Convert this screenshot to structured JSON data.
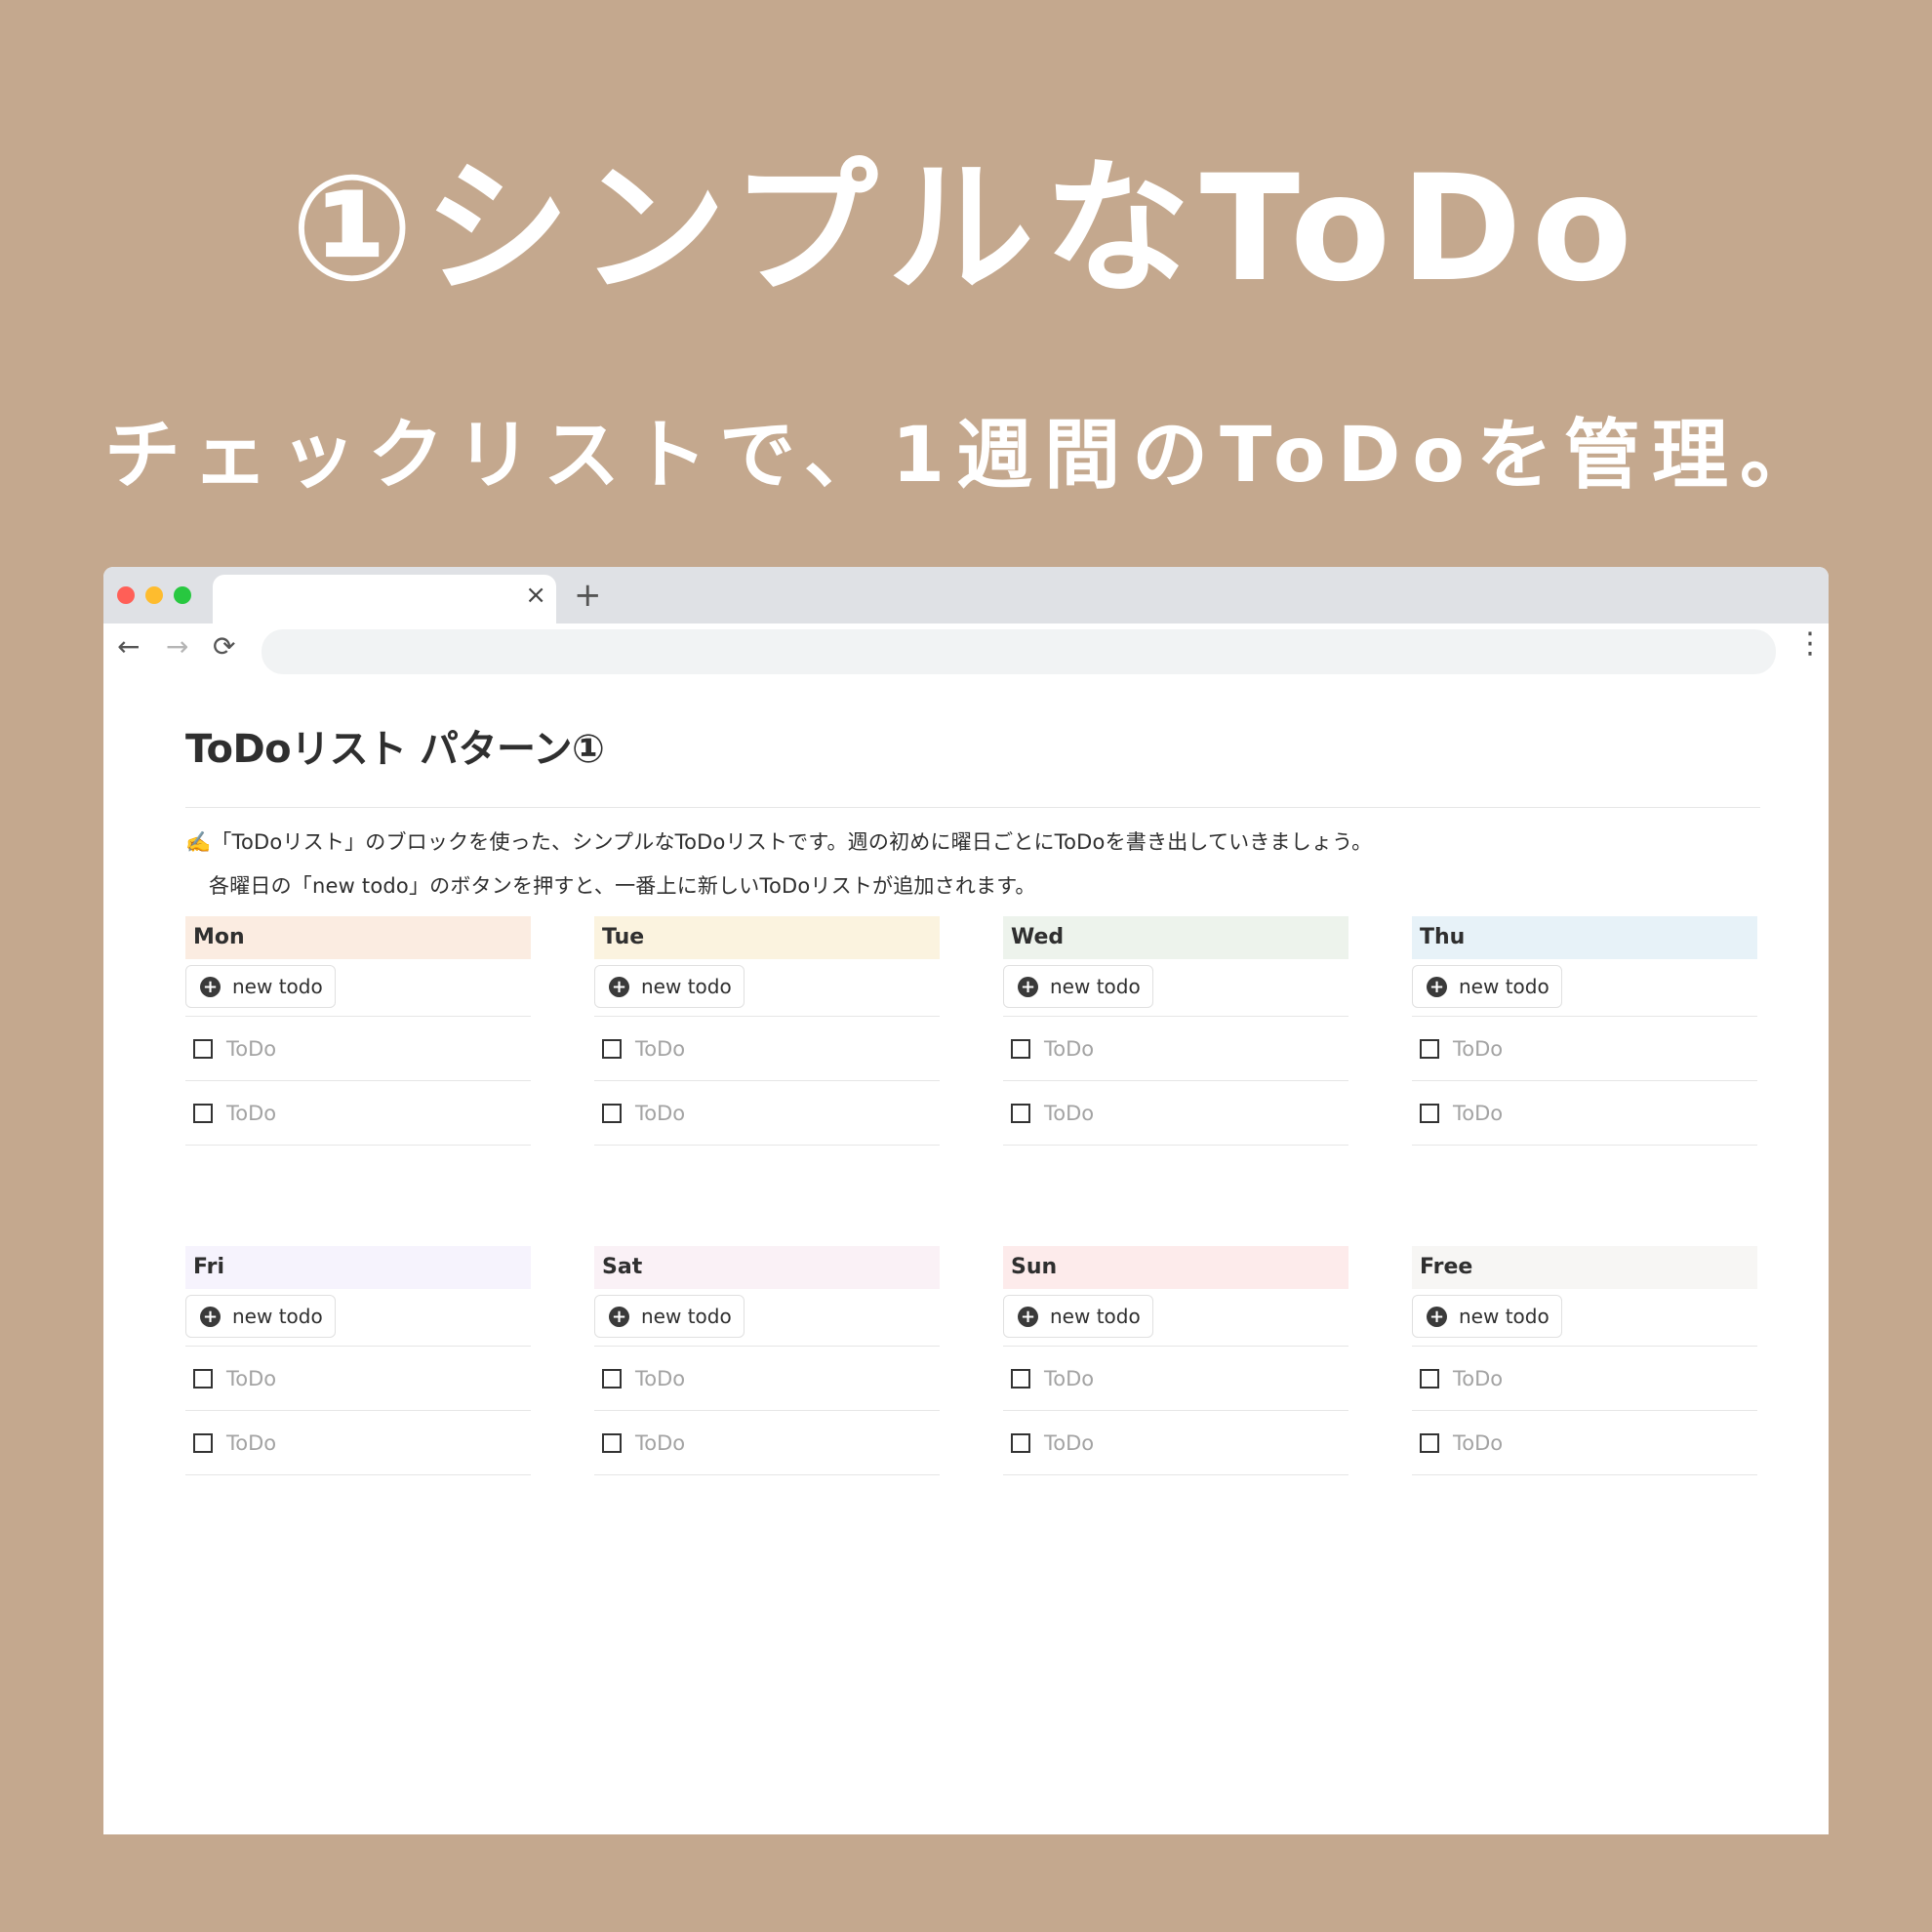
{
  "headline": "①シンプルなToDo",
  "subheadline": "チェックリストで、1週間のToDoを管理。",
  "browser": {
    "tab_close": "×",
    "tab_new": "+",
    "back": "←",
    "forward": "→",
    "reload": "⟳",
    "menu": "⋮",
    "traffic_lights": [
      "#ff5f57",
      "#febc2e",
      "#28c840"
    ]
  },
  "page": {
    "title": "ToDoリスト パターン①",
    "description_1": "✍️「ToDoリスト」のブロックを使った、シンプルなToDoリストです。週の初めに曜日ごとにToDoを書き出していきましょう。",
    "description_2": "各曜日の「new todo」のボタンを押すと、一番上に新しいToDoリストが追加されます。"
  },
  "columns": [
    {
      "label": "Mon",
      "color": "#fbece1",
      "button": "new todo",
      "todos": [
        "ToDo",
        "ToDo"
      ]
    },
    {
      "label": "Tue",
      "color": "#fbf3df",
      "button": "new todo",
      "todos": [
        "ToDo",
        "ToDo"
      ]
    },
    {
      "label": "Wed",
      "color": "#edf3ec",
      "button": "new todo",
      "todos": [
        "ToDo",
        "ToDo"
      ]
    },
    {
      "label": "Thu",
      "color": "#e7f2f8",
      "button": "new todo",
      "todos": [
        "ToDo",
        "ToDo"
      ]
    },
    {
      "label": "Fri",
      "color": "#f6f3fd",
      "button": "new todo",
      "todos": [
        "ToDo",
        "ToDo"
      ]
    },
    {
      "label": "Sat",
      "color": "#faf1f6",
      "button": "new todo",
      "todos": [
        "ToDo",
        "ToDo"
      ]
    },
    {
      "label": "Sun",
      "color": "#fdebeb",
      "button": "new todo",
      "todos": [
        "ToDo",
        "ToDo"
      ]
    },
    {
      "label": "Free",
      "color": "#f7f6f4",
      "button": "new todo",
      "todos": [
        "ToDo",
        "ToDo"
      ]
    }
  ]
}
